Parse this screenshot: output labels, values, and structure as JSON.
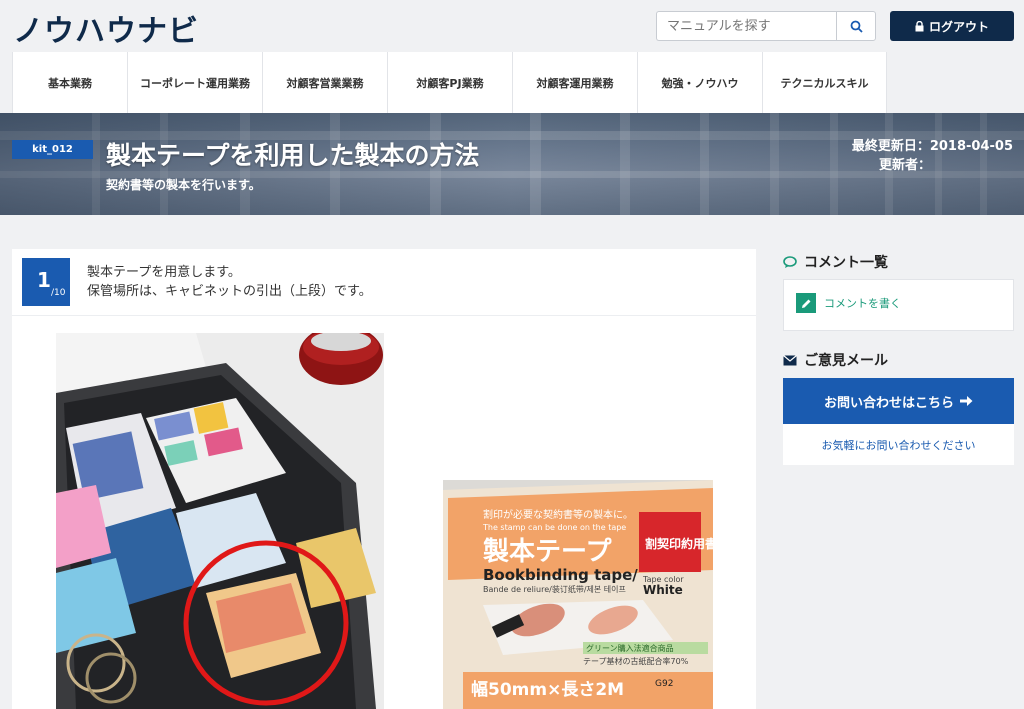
{
  "header": {
    "logo": "ノウハウナビ",
    "search_placeholder": "マニュアルを探す",
    "logout_label": "ログアウト"
  },
  "nav": {
    "items": [
      {
        "label": "基本業務"
      },
      {
        "label": "コーポレート運用業務"
      },
      {
        "label": "対顧客営業業務"
      },
      {
        "label": "対顧客PJ業務"
      },
      {
        "label": "対顧客運用業務"
      },
      {
        "label": "勉強・ノウハウ"
      },
      {
        "label": "テクニカルスキル"
      }
    ]
  },
  "hero": {
    "badge": "kit_012",
    "title": "製本テープを利用した製本の方法",
    "subtitle": "契約書等の製本を行います。",
    "updated_line": "最終更新日：2018-04-05",
    "updater_line": "更新者："
  },
  "step": {
    "number": "1",
    "total": "/10",
    "line1": "製本テープを用意します。",
    "line2": "保管場所は、キャビネットの引出（上段）です。"
  },
  "photo2": {
    "slogan": "割印が必要な契約書等の製本に。",
    "slogan_en": "The stamp can be done on the tape",
    "product": "製本テープ",
    "side_label": "割契印約用書",
    "english": "Bookbinding tape/",
    "french": "Bande de reliure/装订纸带/제본 테이프",
    "color_label": "Tape color",
    "color_value": "White",
    "green_label": "グリーン購入法適合商品",
    "recycled": "テープ基材の古紙配合率70%",
    "size": "幅50mm×長さ2M",
    "code": "G92"
  },
  "sidebar": {
    "comments_title": "コメント一覧",
    "write_comment": "コメントを書く",
    "mail_title": "ご意見メール",
    "contact_button": "お問い合わせはこちら",
    "contact_note": "お気軽にお問い合わせください"
  },
  "colors": {
    "brand_navy": "#0f2a4a",
    "accent_blue": "#1a5bb0",
    "comment_green": "#1a9a7a"
  }
}
